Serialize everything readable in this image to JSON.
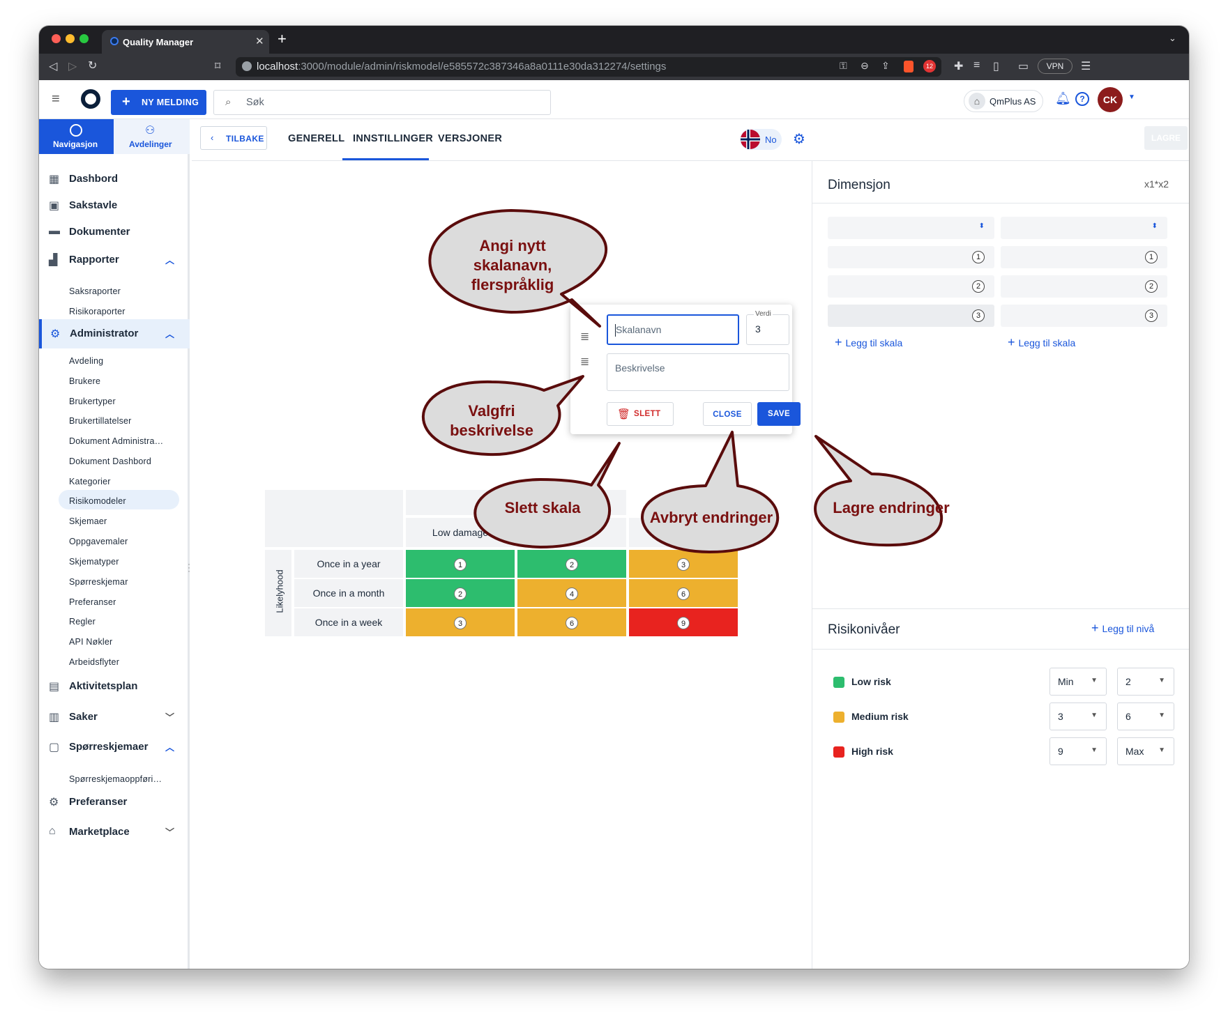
{
  "browser": {
    "tab_title": "Quality Manager",
    "new_tab": "+",
    "url_host": "localhost",
    "url_path": ":3000/module/admin/riskmodel/e585572c387346a8a0111e30da312274/settings",
    "badge_count": "12",
    "vpn_label": "VPN"
  },
  "header": {
    "new_message_label": "NY MELDING",
    "search_placeholder": "Søk",
    "company": "QmPlus AS",
    "avatar_initials": "CK"
  },
  "sidebar": {
    "tabs": [
      "Navigasjon",
      "Avdelinger"
    ],
    "items": {
      "dashbord": "Dashbord",
      "sakstavle": "Sakstavle",
      "dokumenter": "Dokumenter",
      "rapporter": "Rapporter",
      "administrator": "Administrator",
      "aktivitetsplan": "Aktivitetsplan",
      "saker": "Saker",
      "sporreskjemaer": "Spørreskjemaer",
      "preferanser": "Preferanser",
      "marketplace": "Marketplace"
    },
    "rapporter_sub": [
      "Saksraporter",
      "Risikoraporter"
    ],
    "admin_sub": [
      "Avdeling",
      "Brukere",
      "Brukertyper",
      "Brukertillatelser",
      "Dokument Administra…",
      "Dokument Dashbord",
      "Kategorier",
      "Risikomodeler",
      "Skjemaer",
      "Oppgavemaler",
      "Skjematyper",
      "Spørreskjemar",
      "Preferanser",
      "Regler",
      "API Nøkler",
      "Arbeidsflyter"
    ],
    "sporre_sub": [
      "Spørreskjemaoppføri…"
    ]
  },
  "topnav": {
    "back": "TILBAKE",
    "tabs": [
      "GENERELL",
      "INNSTILLINGER",
      "VERSJONER"
    ],
    "lang": "No",
    "save": "LAGRE"
  },
  "dimension": {
    "title": "Dimensjon",
    "formula": "x1*x2",
    "col1": [
      "1",
      "2",
      "3"
    ],
    "col2": [
      "1",
      "2",
      "3"
    ],
    "add_scale": "Legg til skala"
  },
  "risk_levels": {
    "title": "Risikonivåer",
    "add_level": "Legg til nivå",
    "levels": [
      {
        "name": "Low risk",
        "color": "#2dbd6e",
        "from": "Min",
        "to": "2"
      },
      {
        "name": "Medium risk",
        "color": "#edb02e",
        "from": "3",
        "to": "6"
      },
      {
        "name": "High risk",
        "color": "#e8231f",
        "from": "9",
        "to": "Max"
      }
    ]
  },
  "matrix": {
    "row_axis": "Likelyhood",
    "col_header_first": "Low damage",
    "rows": [
      {
        "label": "Once in a year",
        "values": [
          "1",
          "2",
          "3"
        ]
      },
      {
        "label": "Once in a month",
        "values": [
          "2",
          "4",
          "6"
        ]
      },
      {
        "label": "Once in a week",
        "values": [
          "3",
          "6",
          "9"
        ]
      }
    ],
    "colors": {
      "green": "#2dbd6e",
      "orange": "#edb02e",
      "red": "#e8231f"
    }
  },
  "popup": {
    "name_placeholder": "Skalanavn",
    "value_label": "Verdi",
    "value": "3",
    "desc_placeholder": "Beskrivelse",
    "delete": "SLETT",
    "close": "CLOSE",
    "save": "SAVE"
  },
  "callouts": {
    "c1_lines": [
      "Angi nytt",
      "skalanavn,",
      "flerspråklig"
    ],
    "c2_lines": [
      "Valgfri",
      "beskrivelse"
    ],
    "c3": "Slett skala",
    "c4": "Avbryt endringer",
    "c5": "Lagre endringer"
  }
}
